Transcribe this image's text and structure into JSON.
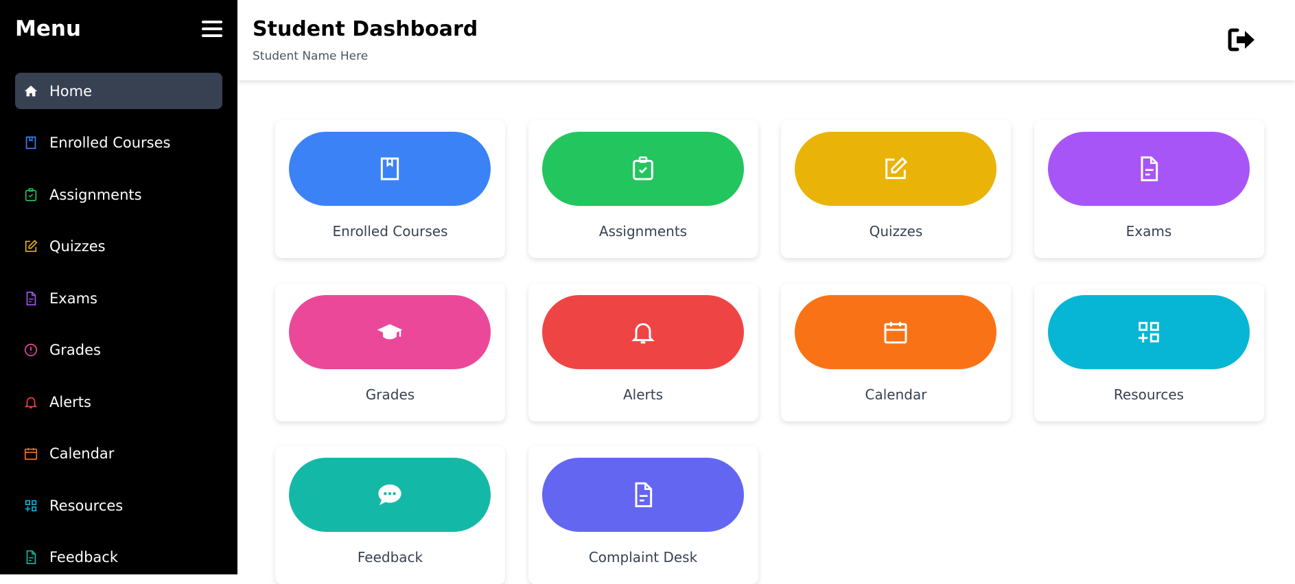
{
  "sidebar": {
    "title": "Menu",
    "items": [
      {
        "label": "Home",
        "icon": "home-icon",
        "color": "#ffffff",
        "active": true
      },
      {
        "label": "Enrolled Courses",
        "icon": "book-icon",
        "color": "#3b82f6"
      },
      {
        "label": "Assignments",
        "icon": "clipboard-check-icon",
        "color": "#22c55e"
      },
      {
        "label": "Quizzes",
        "icon": "edit-icon",
        "color": "#eab308"
      },
      {
        "label": "Exams",
        "icon": "document-icon",
        "color": "#a855f7"
      },
      {
        "label": "Grades",
        "icon": "alert-circle-icon",
        "color": "#ec4899"
      },
      {
        "label": "Alerts",
        "icon": "bell-icon",
        "color": "#ef4444"
      },
      {
        "label": "Calendar",
        "icon": "calendar-icon",
        "color": "#f97316"
      },
      {
        "label": "Resources",
        "icon": "grid-plus-icon",
        "color": "#06b6d4"
      },
      {
        "label": "Feedback",
        "icon": "document-icon",
        "color": "#14b8a6"
      }
    ]
  },
  "header": {
    "title": "Student Dashboard",
    "subtitle": "Student Name Here",
    "logout_icon": "logout-icon"
  },
  "cards": [
    {
      "label": "Enrolled Courses",
      "icon": "book-icon",
      "color": "#3b82f6"
    },
    {
      "label": "Assignments",
      "icon": "clipboard-check-icon",
      "color": "#22c55e"
    },
    {
      "label": "Quizzes",
      "icon": "edit-icon",
      "color": "#eab308"
    },
    {
      "label": "Exams",
      "icon": "document-icon",
      "color": "#a855f7"
    },
    {
      "label": "Grades",
      "icon": "graduation-cap-icon",
      "color": "#ec4899"
    },
    {
      "label": "Alerts",
      "icon": "bell-icon",
      "color": "#ef4444"
    },
    {
      "label": "Calendar",
      "icon": "calendar-icon",
      "color": "#f97316"
    },
    {
      "label": "Resources",
      "icon": "grid-plus-icon",
      "color": "#06b6d4"
    },
    {
      "label": "Feedback",
      "icon": "chat-icon",
      "color": "#14b8a6"
    },
    {
      "label": "Complaint Desk",
      "icon": "document-icon",
      "color": "#6366f1"
    }
  ]
}
